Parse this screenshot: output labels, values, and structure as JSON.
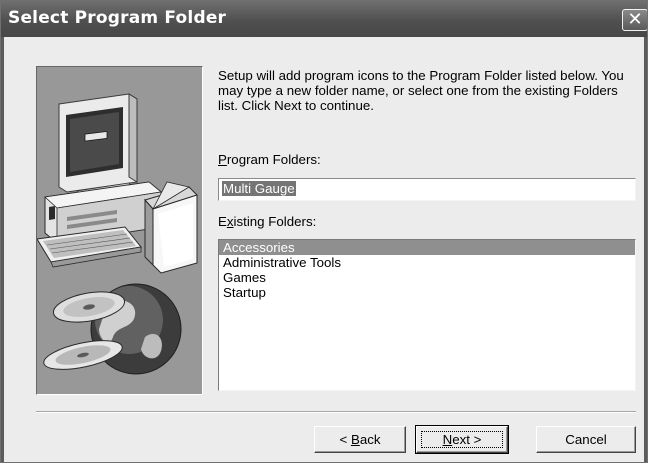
{
  "window": {
    "title": "Select Program Folder",
    "close_glyph": "✕"
  },
  "description": "Setup will add program icons to the Program Folder listed below. You may type a new folder name, or select one from the existing Folders list.  Click Next to continue.",
  "program_folders": {
    "label_mnemonic": "P",
    "label_rest": "rogram Folders:",
    "value": "Multi Gauge"
  },
  "existing_folders": {
    "label_pre": "E",
    "label_mnemonic": "x",
    "label_rest": "isting Folders:",
    "items": [
      "Accessories",
      "Administrative Tools",
      "Games",
      "Startup"
    ],
    "selected_index": 0
  },
  "buttons": {
    "back": {
      "prefix": "< ",
      "mnemonic": "B",
      "rest": "ack"
    },
    "next": {
      "mnemonic": "N",
      "rest": "ext >"
    },
    "cancel": {
      "label": "Cancel"
    }
  },
  "icons": [
    "computer-icon",
    "software-box-icon",
    "cd-disc-icon",
    "globe-icon"
  ]
}
